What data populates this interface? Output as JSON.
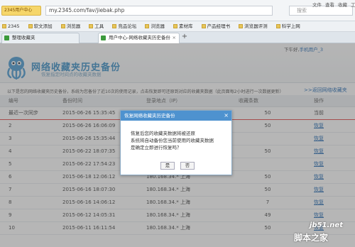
{
  "browser": {
    "logo_label": "2345用户中心",
    "url": "my.2345.com/fav/jiebak.php",
    "search_placeholder": "搜索",
    "menus": [
      "文件",
      "查看",
      "收藏",
      "工具"
    ],
    "bookmarks": [
      "2345",
      "软文添加",
      "浏览器",
      "工具",
      "竞品论坛",
      "浏览器",
      "素材库",
      "产品经理书",
      "浏览器评测",
      "科学上网"
    ],
    "tabs": [
      {
        "label": "整理收藏夹"
      },
      {
        "label": "用户中心-网络收藏夹历史备份",
        "active": true
      }
    ]
  },
  "header": {
    "top_right_prefix": "下午好,",
    "top_right_user": "手机用户_3",
    "title": "网络收藏夹历史备份",
    "subtitle": "恢复指定时间点的收藏夹数据"
  },
  "notice": "以下是您的网络收藏夹历史备份，系统为您备份了近10次的使用记录，点击恢复即可还原到对应的收藏夹数据（此页面每2小时进行一次数据更新）",
  "back_link": ">>返回网络收藏夹",
  "table": {
    "headers": [
      "编号",
      "备份时间",
      "登录地点（IP）",
      "收藏条数",
      "操作"
    ],
    "rows": [
      {
        "id": "最近一次同步",
        "time": "2015-06-26 15:35:45",
        "ip": "",
        "count": "50",
        "action": "当前"
      },
      {
        "id": "2",
        "time": "2015-06-26 16:06:09",
        "ip": "",
        "count": "50",
        "action": "恢复"
      },
      {
        "id": "3",
        "time": "2015-06-26 15:35:44",
        "ip": "",
        "count": "",
        "action": "恢复"
      },
      {
        "id": "4",
        "time": "2015-06-22 18:07:35",
        "ip": "",
        "count": "50",
        "action": "恢复"
      },
      {
        "id": "5",
        "time": "2015-06-22 17:54:23",
        "ip": "",
        "count": "",
        "action": "恢复"
      },
      {
        "id": "6",
        "time": "2015-06-18 12:06:12",
        "ip": "180.168.34.*  上海",
        "count": "50",
        "action": "恢复"
      },
      {
        "id": "7",
        "time": "2015-06-16 18:07:30",
        "ip": "180.168.34.*  上海",
        "count": "50",
        "action": "恢复"
      },
      {
        "id": "8",
        "time": "2015-06-16 14:06:12",
        "ip": "180.168.34.*  上海",
        "count": "7",
        "action": "恢复"
      },
      {
        "id": "9",
        "time": "2015-06-12 14:05:31",
        "ip": "180.168.34.*  上海",
        "count": "49",
        "action": "恢复"
      },
      {
        "id": "10",
        "time": "2015-06-11 16:11:54",
        "ip": "180.168.34.*  上海",
        "count": "50",
        "action": "恢复"
      }
    ]
  },
  "dialog": {
    "title": "恢复网络收藏夹历史备份",
    "close": "×",
    "line1": "恢复后您的收藏夹数据将被还原",
    "line2": "系统将自动备份您当前使用的收藏夹数据",
    "line3": "是确定立即进行恢复吗？",
    "yes": "是",
    "no": "否"
  },
  "watermark": {
    "line1": "jb51.net",
    "line2": "脚本之家"
  }
}
